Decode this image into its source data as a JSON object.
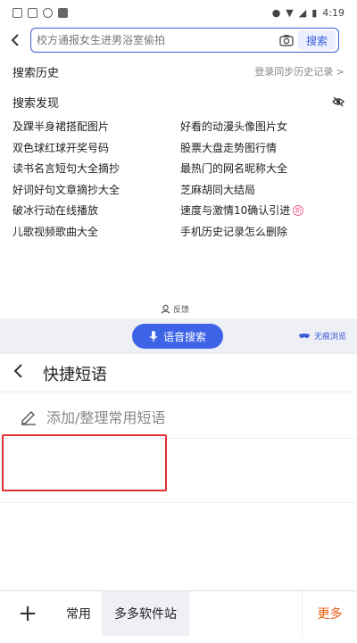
{
  "status_bar": {
    "time": "4:19"
  },
  "search": {
    "placeholder": "校方通报女生进男浴室偷拍",
    "button_label": "搜索"
  },
  "history": {
    "title": "搜索历史",
    "login_link": "登录同步历史记录 >"
  },
  "discover": {
    "title": "搜索发现",
    "items": [
      "及踝半身裙搭配图片",
      "好看的动漫头像图片女",
      "双色球红球开奖号码",
      "股票大盘走势图行情",
      "读书名言短句大全摘抄",
      "最热门的网名昵称大全",
      "好词好句文章摘抄大全",
      "芝麻胡同大结局",
      "破冰行动在线播放",
      "速度与激情10确认引进",
      "儿歌视频歌曲大全",
      "手机历史记录怎么删除"
    ],
    "new_badge": "新"
  },
  "feedback_label": "反馈",
  "voice_search_label": "语音搜索",
  "incognito_label": "无痕浏览",
  "quick_panel": {
    "title": "快捷短语",
    "add_label": "添加/整理常用短语"
  },
  "bottom_bar": {
    "plus": "+",
    "tab_common": "常用",
    "tab_active": "多多软件站",
    "more": "更多"
  },
  "colors": {
    "accent": "#3b5bdb",
    "voice_button": "#3d63e6",
    "highlight_box": "#e03131",
    "more": "#e8590c"
  }
}
